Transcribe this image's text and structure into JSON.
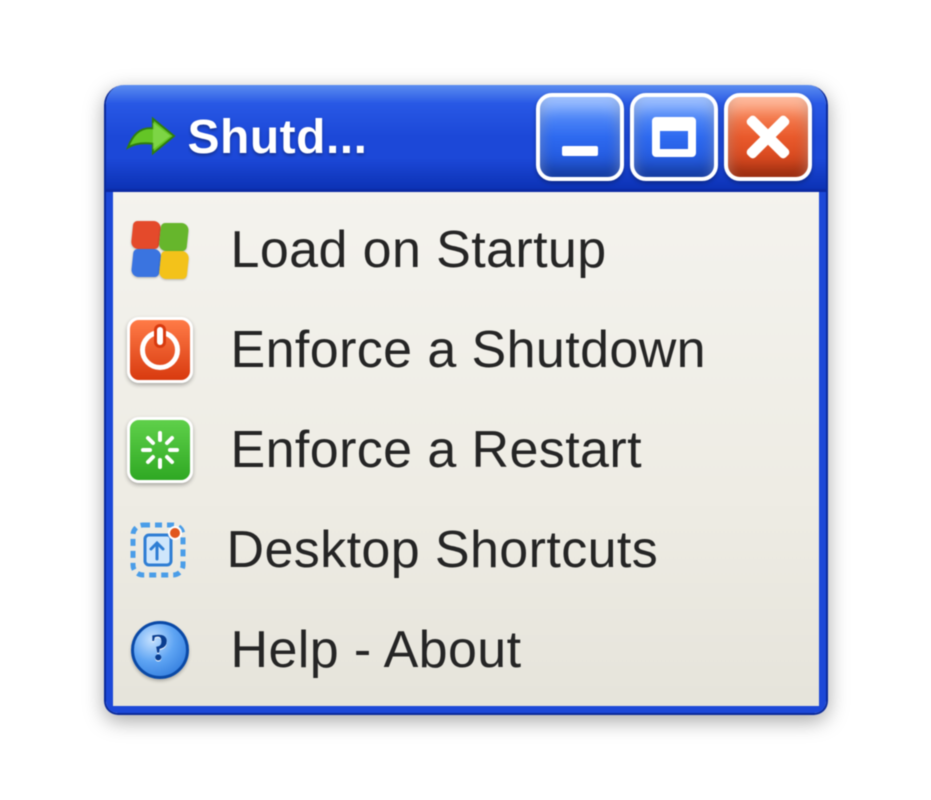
{
  "window": {
    "title": "Shutd..."
  },
  "menu": {
    "items": [
      {
        "icon": "windows-flag-icon",
        "label": "Load on Startup"
      },
      {
        "icon": "power-red-icon",
        "label": "Enforce a Shutdown"
      },
      {
        "icon": "restart-green-icon",
        "label": "Enforce a Restart"
      },
      {
        "icon": "desktop-shortcut-icon",
        "label": "Desktop Shortcuts"
      },
      {
        "icon": "help-icon",
        "label": "Help - About"
      }
    ]
  }
}
